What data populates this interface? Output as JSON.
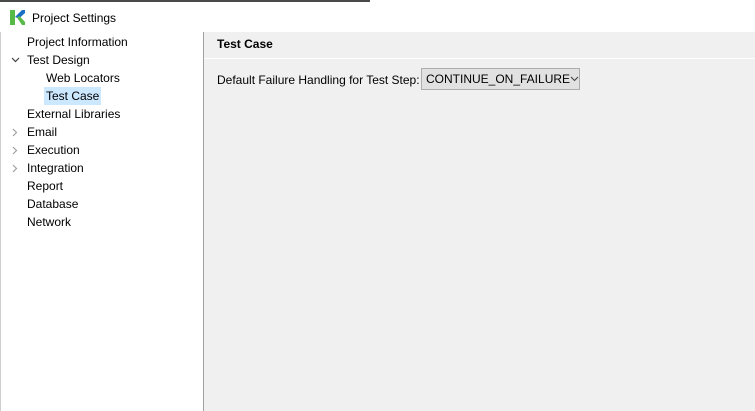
{
  "window": {
    "title": "Project Settings",
    "icon": "katalon-k-logo"
  },
  "sidebar": {
    "items": [
      {
        "label": "Project Information",
        "expander": "none",
        "selected": false
      },
      {
        "label": "Test Design",
        "expander": "expanded",
        "selected": false
      },
      {
        "label": "Web Locators",
        "expander": "none",
        "selected": false
      },
      {
        "label": "Test Case",
        "expander": "none",
        "selected": true
      },
      {
        "label": "External Libraries",
        "expander": "none",
        "selected": false
      },
      {
        "label": "Email",
        "expander": "collapsed",
        "selected": false
      },
      {
        "label": "Execution",
        "expander": "collapsed",
        "selected": false
      },
      {
        "label": "Integration",
        "expander": "collapsed",
        "selected": false
      },
      {
        "label": "Report",
        "expander": "none",
        "selected": false
      },
      {
        "label": "Database",
        "expander": "none",
        "selected": false
      },
      {
        "label": "Network",
        "expander": "none",
        "selected": false
      }
    ]
  },
  "content": {
    "title": "Test Case",
    "failure_handling": {
      "label": "Default Failure Handling for Test Step:",
      "value": "CONTINUE_ON_FAILURE",
      "icon": "chevron-down-icon"
    }
  },
  "colors": {
    "selection": "#cce8ff",
    "panel": "#f0f0f0",
    "logo_green": "#57b947",
    "logo_blue": "#1a6fc2"
  }
}
